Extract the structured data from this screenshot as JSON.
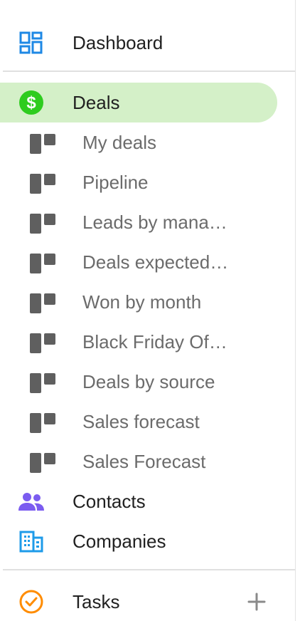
{
  "nav": {
    "dashboard": {
      "label": "Dashboard",
      "icon": "dashboard-icon"
    },
    "deals": {
      "label": "Deals",
      "icon": "dollar-icon"
    },
    "deal_views": [
      {
        "label": "My deals"
      },
      {
        "label": "Pipeline"
      },
      {
        "label": "Leads by mana…"
      },
      {
        "label": "Deals expected…"
      },
      {
        "label": "Won by month"
      },
      {
        "label": "Black Friday Of…"
      },
      {
        "label": "Deals by source"
      },
      {
        "label": "Sales forecast"
      },
      {
        "label": "Sales Forecast"
      }
    ],
    "contacts": {
      "label": "Contacts",
      "icon": "people-icon"
    },
    "companies": {
      "label": "Companies",
      "icon": "building-icon"
    },
    "tasks": {
      "label": "Tasks",
      "icon": "check-circle-icon"
    }
  },
  "colors": {
    "active_bg": "#d4f0c8",
    "deals_icon": "#2ecc1f",
    "dashboard_icon": "#1e88e5",
    "contacts_icon": "#7b5cf0",
    "companies_icon": "#1e9be9",
    "tasks_icon": "#ff8c00",
    "view_icon": "#5f5f5f"
  }
}
